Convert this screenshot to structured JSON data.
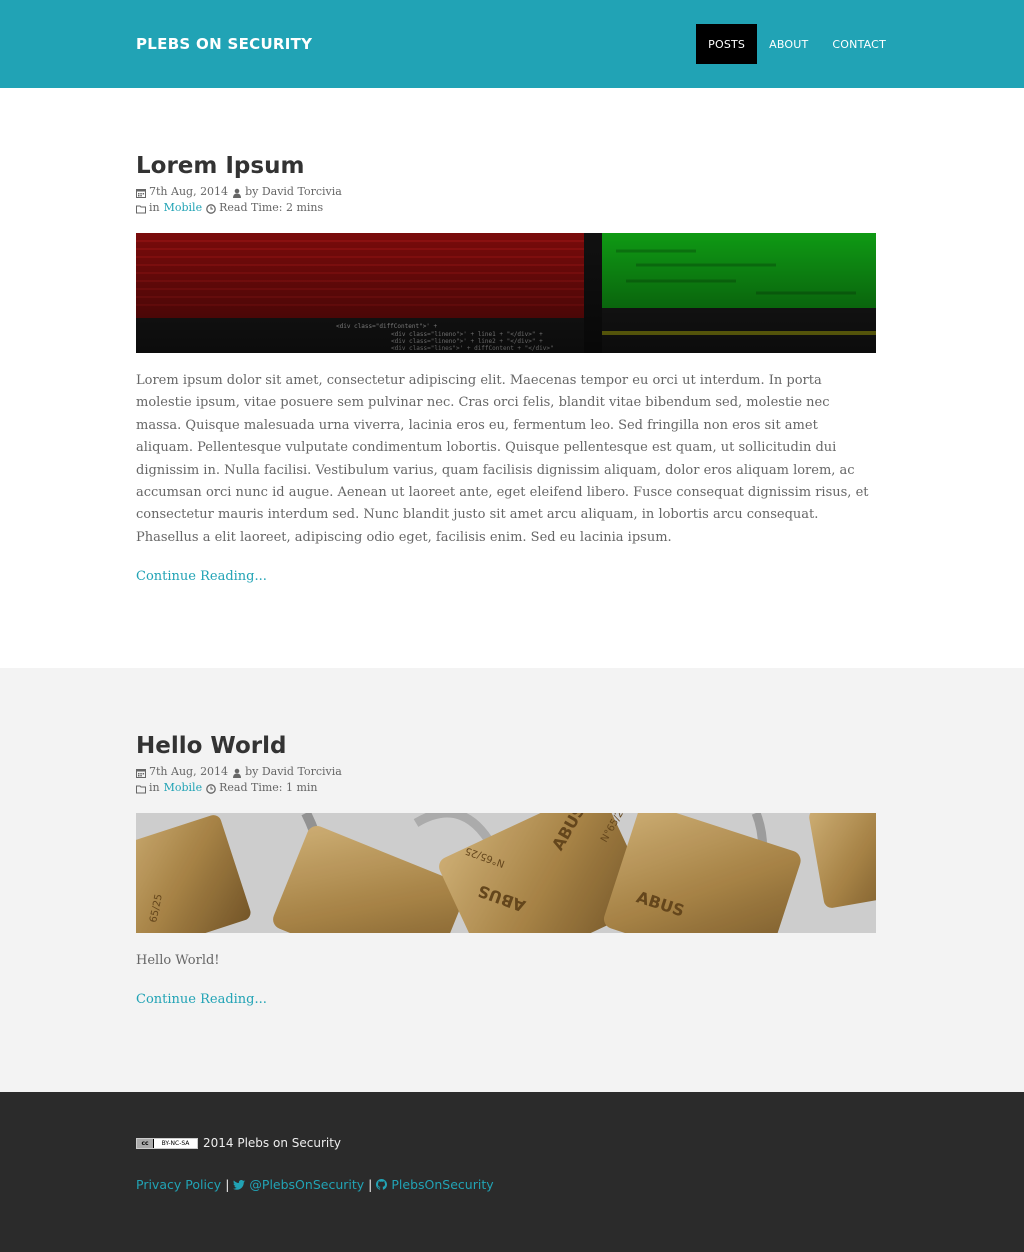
{
  "site": {
    "brand": "PLEBS ON SECURITY",
    "nav": [
      {
        "label": "POSTS",
        "active": true
      },
      {
        "label": "ABOUT",
        "active": false
      },
      {
        "label": "CONTACT",
        "active": false
      }
    ]
  },
  "posts": [
    {
      "title": "Lorem Ipsum",
      "date": "7th Aug, 2014",
      "author": "by David Torcivia",
      "in_label": "in",
      "category": "Mobile",
      "read_time": "Read Time: 2 mins",
      "body": "Lorem ipsum dolor sit amet, consectetur adipiscing elit. Maecenas tempor eu orci ut interdum. In porta molestie ipsum, vitae posuere sem pulvinar nec. Cras orci felis, blandit vitae bibendum sed, molestie nec massa. Quisque malesuada urna viverra, lacinia eros eu, fermentum leo. Sed fringilla non eros sit amet aliquam. Pellentesque vulputate condimentum lobortis. Quisque pellentesque est quam, ut sollicitudin dui dignissim in. Nulla facilisi. Vestibulum varius, quam facilisis dignissim aliquam, dolor eros aliquam lorem, ac accumsan orci nunc id augue. Aenean ut laoreet ante, eget eleifend libero. Fusce consequat dignissim risus, et consectetur mauris interdum sed. Nunc blandit justo sit amet arcu aliquam, in lobortis arcu consequat. Phasellus a elit laoreet, adipiscing odio eget, facilisis enim. Sed eu lacinia ipsum.",
      "continue": "Continue Reading..."
    },
    {
      "title": "Hello World",
      "date": "7th Aug, 2014",
      "author": "by David Torcivia",
      "in_label": "in",
      "category": "Mobile",
      "read_time": "Read Time: 1 min",
      "body": "Hello World!",
      "continue": "Continue Reading..."
    }
  ],
  "footer": {
    "license_badge": [
      "cc",
      "BY-NC-SA"
    ],
    "copyright": "2014 Plebs on Security",
    "links": {
      "privacy": "Privacy Policy",
      "twitter": "@PlebsOnSecurity",
      "github": "PlebsOnSecurity",
      "separator": "|"
    }
  },
  "colors": {
    "accent": "#21a3b5",
    "footer_bg": "#2b2b2b",
    "alt_section_bg": "#f3f3f3",
    "nav_active_bg": "#000000"
  },
  "icons": [
    "calendar-icon",
    "user-icon",
    "folder-icon",
    "clock-icon",
    "twitter-icon",
    "github-icon",
    "cc-license-badge"
  ]
}
